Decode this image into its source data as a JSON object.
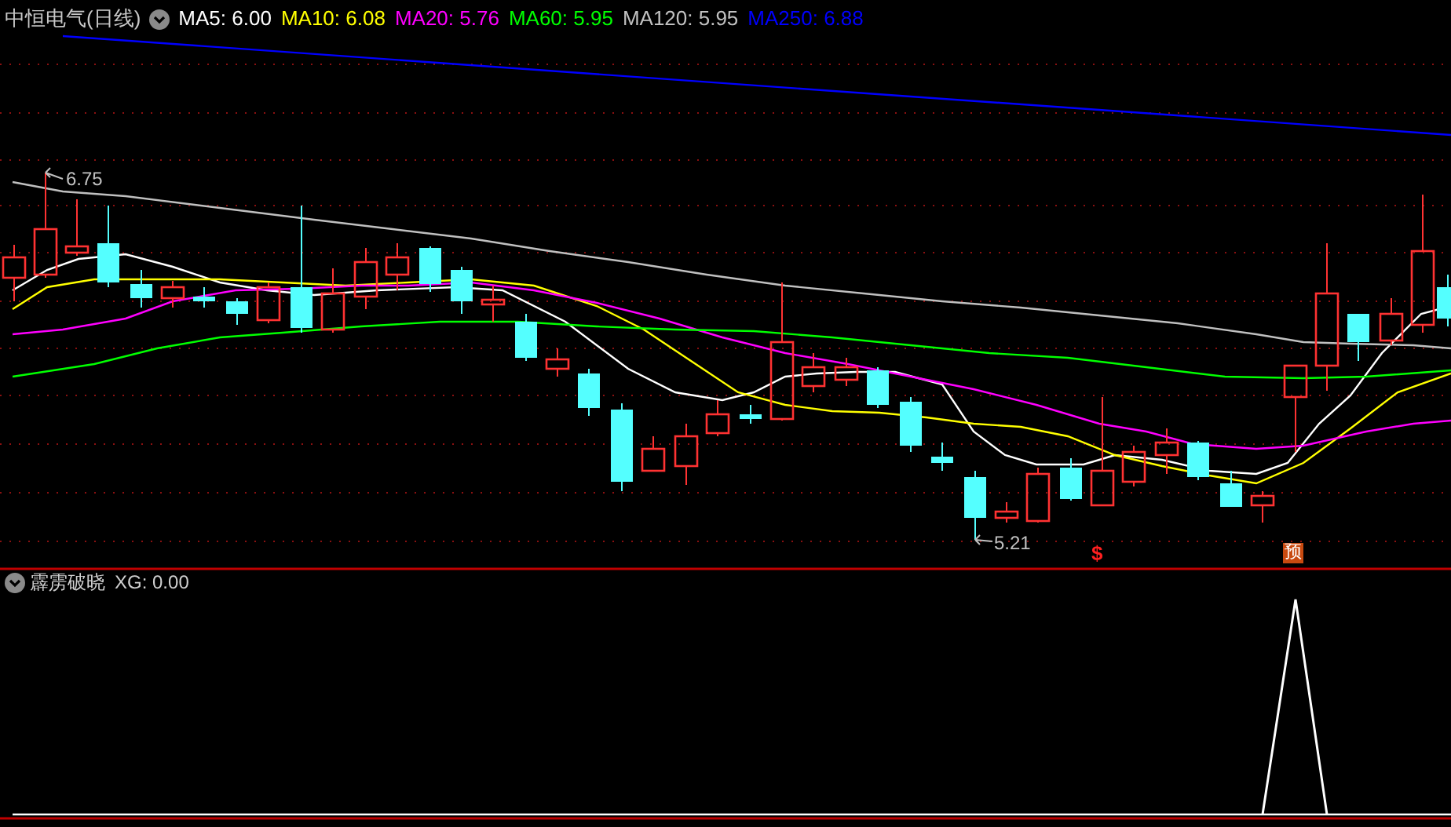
{
  "main_panel": {
    "title": "中恒电气(日线)",
    "indicators": [
      {
        "label": "MA5: 6.00",
        "color": "#ffffff"
      },
      {
        "label": "MA10: 6.08",
        "color": "#ffff00"
      },
      {
        "label": "MA20: 5.76",
        "color": "#ff00ff"
      },
      {
        "label": "MA60: 5.95",
        "color": "#00ff00"
      },
      {
        "label": "MA120: 5.95",
        "color": "#c0c0c0"
      },
      {
        "label": "MA250: 6.88",
        "color": "#0000ff"
      }
    ],
    "high_label": "6.75",
    "low_label": "5.21",
    "signals": [
      {
        "kind": "dollar",
        "text": "$"
      },
      {
        "kind": "forecast",
        "text": "预"
      }
    ]
  },
  "sub_panel": {
    "title": "霹雳破晓",
    "reading": "XG: 0.00"
  }
}
